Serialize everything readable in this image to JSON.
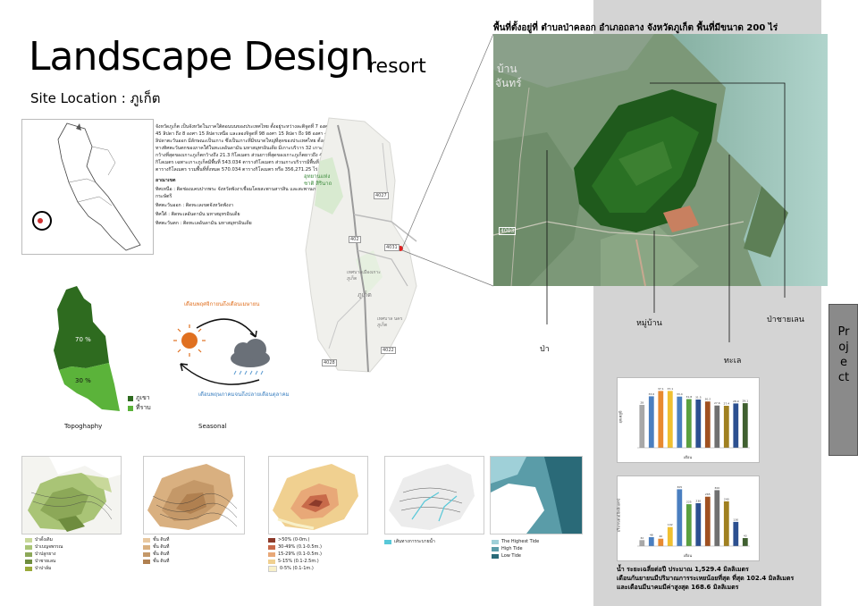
{
  "header": {
    "title": "Landscape Design",
    "title_suffix": "resort",
    "site_location": "Site Location : ภูเก็ต"
  },
  "site_info": "พื้นที่ตั้งอยู่ที่ ตำบลป่าคลอก อำเภอถลาง จังหวัดภูเก็ต พื้นที่มีขนาด 200 ไร่",
  "description": {
    "paragraph": "จังหวัดภูเก็ต เป็นจังหวัดในภาคใต้ตอนบนของประเทศไทย ตั้งอยู่ระหว่างละติจูดที่ 7 องศา 45 ลิปดา ถึง 8 องศา 15 ลิปดาเหนือ และลองจิจูดที่ 98 องศา 15 ลิปดา ถึง 98 องศา 40 ลิปดาตะวันออก มีลักษณะเป็นเกาะ ซึ่งเป็นเกาะที่มีขนาดใหญ่ที่สุดของประเทศไทย ตั้งอยู่ทางทิศตะวันตกของภาคใต้ในทะเลอันดามัน มหาสมุทรอินเดีย มีเกาะบริวาร 32 เกาะ ส่วนกว้างที่สุดของเกาะภูเก็ตกว้างถึง 21.3 กิโลเมตร ส่วนยาวที่สุดของเกาะภูเก็ตยาวถึง 48.7 กิโลเมตร เฉพาะเกาะภูเก็ตมีพื้นที่ 543.034 ตารางกิโลเมตร ส่วนเกาะบริวารมีพื้นที่ 27 ตารางกิโลเมตร รวมพื้นที่ทั้งหมด 570.034 ตารางกิโลเมตร หรือ 356,271.25 ไร่",
    "boundary_heading": "อาณาเขต",
    "boundaries": [
      "ทิศเหนือ : ติดช่องแคบปากพระ จังหวัดพังงาเชื่อมโดยสะพานสารสิน และสะพานเทพกระษัตรี",
      "ทิศตะวันออก : ติดทะเลเขตจังหวัดพังงา",
      "ทิศใต้ : ติดทะเลอันดามัน มหาสมุทรอินเดีย",
      "ทิศตะวันตก : ติดทะเลอันดามัน มหาสมุทรอินเดีย"
    ]
  },
  "map_labels": {
    "park": "อุทยานแห่งชาติ สิรินาถ",
    "town1": "เทศบาลเมืองเกาะภูเก็ต",
    "town2": "ภูเก็ต",
    "town3": "เทศบาล นครภูเก็ต",
    "road1": "4027",
    "road2": "402",
    "road3": "4031",
    "road4": "4028",
    "road5": "4022"
  },
  "aerial": {
    "text_overlay_1": "บ้าน",
    "text_overlay_2": "จันทร์",
    "road": "4003"
  },
  "annotations": {
    "forest": "ป่า",
    "village": "หมู่บ้าน",
    "sea": "ทะเล",
    "mangrove": "ป่าชายเลน"
  },
  "topography": {
    "caption": "Topoghaphy",
    "pct_top": "70 %",
    "pct_bottom": "30 %",
    "legend": [
      {
        "label": "ภูเขา",
        "color": "#2e6b1f"
      },
      {
        "label": "ที่ราบ",
        "color": "#5bb33a"
      }
    ]
  },
  "seasonal": {
    "caption": "Seasonal",
    "top_text": "เดือนพฤศจิกายนถึงเดือนเมษายน",
    "bottom_text": "เดือนพฤษภาคมจนถึงปลายเดือนตุลาคม"
  },
  "analysis_maps": [
    {
      "legend": [
        {
          "label": "ป่าดั้งเดิม",
          "color": "#c8d89a"
        },
        {
          "label": "ป่าเบญจพรรณ",
          "color": "#a9c476"
        },
        {
          "label": "ป่าปลูกยาง",
          "color": "#8ca858"
        },
        {
          "label": "ป่าชายเลน",
          "color": "#6e8c3e"
        },
        {
          "label": "ป่าปาล์ม",
          "color": "#9aaa3a"
        }
      ]
    },
    {
      "legend": [
        {
          "label": "ชั้น ดินที่",
          "color": "#e8c8a0"
        },
        {
          "label": "ชั้น ดินที่",
          "color": "#d9b080"
        },
        {
          "label": "ชั้น ดินที่",
          "color": "#c49868"
        },
        {
          "label": "ชั้น ดินที่",
          "color": "#b08050"
        }
      ]
    },
    {
      "legend": [
        {
          "label": ">50% (0-0m.)",
          "color": "#8c3a2a"
        },
        {
          "label": "30-49% (0.1-0.5m.)",
          "color": "#c86a4a"
        },
        {
          "label": "15-29% (0.1-0.5m.)",
          "color": "#e8a878"
        },
        {
          "label": "5-15% (0.1-2.5m.)",
          "color": "#f0d090"
        },
        {
          "label": "0-5% (0.1-1m.)",
          "color": "#f8f0c8"
        }
      ]
    },
    {
      "legend": [
        {
          "label": "เส้นทางการระบายน้ำ",
          "color": "#58c8d8"
        }
      ]
    },
    {
      "legend": [
        {
          "label": "The Highest Tide",
          "color": "#9fd0d8"
        },
        {
          "label": "High Tide",
          "color": "#5a9ca8"
        },
        {
          "label": "Low Tide",
          "color": "#2a6a78"
        }
      ]
    }
  ],
  "charts": {
    "colors": [
      "#a8a8a8",
      "#4a7fc0",
      "#e88a30",
      "#f0c030",
      "#4a7fc0",
      "#5aa040",
      "#2c5090",
      "#a05020",
      "#707070",
      "#a08020",
      "#2c5090",
      "#406030"
    ],
    "chart1_ylabel": "อุณหภูมิ",
    "chart1_xlabel": "เดือน",
    "chart2_ylabel": "ปริมาณฝน(มิลลิเมตร)",
    "chart2_xlabel": "เดือน"
  },
  "chart_data": [
    {
      "type": "bar",
      "categories": [
        "1",
        "2",
        "3",
        "4",
        "5",
        "6",
        "7",
        "8",
        "9",
        "10",
        "11",
        "12"
      ],
      "values": [
        28,
        33.6,
        37.1,
        37.1,
        33.4,
        31.8,
        31.5,
        30.2,
        27.6,
        27.4,
        28.9,
        29.1
      ],
      "title": "",
      "xlabel": "เดือน",
      "ylabel": "อุณหภูมิ"
    },
    {
      "type": "bar",
      "categories": [
        "1",
        "2",
        "3",
        "4",
        "5",
        "6",
        "7",
        "8",
        "9",
        "10",
        "11",
        "12"
      ],
      "values": [
        32,
        48,
        40,
        102,
        305,
        225,
        230,
        265,
        300,
        240,
        130,
        43
      ],
      "title": "",
      "xlabel": "เดือน",
      "ylabel": "ปริมาณฝน(มิลลิเมตร)"
    }
  ],
  "bottom_note": {
    "line1": "น้ำ ระยะเฉลี่ยต่อปี ประมาณ 1,529.4 มิลลิเมตร",
    "line2": "เดือนกันยายนมีปริมาณการระเหยน้อยที่สุด ที่สุด 102.4 มิลลิเมตร",
    "line3": "และเดือนมีนาคมมีค่าสูงสุด 168.6 มิลลิเมตร"
  },
  "side_tab": "Project"
}
